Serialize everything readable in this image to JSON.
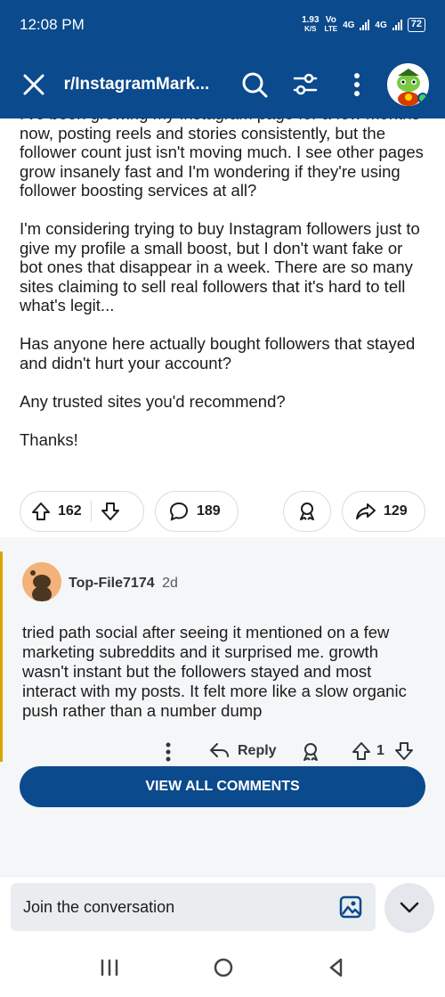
{
  "status_bar": {
    "time": "12:08 PM",
    "speed_value": "1.93",
    "speed_unit": "K/S",
    "volte_top": "Vo",
    "volte_bottom": "LTE",
    "net1": "4G",
    "net2": "4G",
    "battery": "72"
  },
  "header": {
    "subreddit": "r/InstagramMark...",
    "icons": [
      "close-icon",
      "search-icon",
      "filter-icon",
      "more-vertical-icon"
    ]
  },
  "post": {
    "paragraphs": [
      "I've been growing my Instagram page for a few months now, posting reels and stories consistently, but the follower count just isn't moving much. I see other pages grow insanely fast and I'm wondering if they're using follower boosting services at all?",
      "I'm considering trying to buy Instagram followers just to give my profile a small boost, but I don't want fake or bot ones that disappear in a week. There are so many sites claiming to sell real followers that it's hard to tell what's legit...",
      "Has anyone here actually bought followers that stayed and didn't hurt your account?",
      "Any trusted sites you'd recommend?",
      "Thanks!"
    ],
    "upvotes": "162",
    "comments": "189",
    "shares": "129"
  },
  "comment": {
    "username": "Top-File7174",
    "age": "2d",
    "body": "tried path social after seeing it mentioned on a few marketing subreddits and it surprised me. growth wasn't instant but the followers stayed and most interact with my posts. It felt more like a slow organic push rather than a number dump",
    "reply_label": "Reply",
    "votes": "1"
  },
  "view_all_label": "VIEW ALL COMMENTS",
  "composer": {
    "placeholder": "Join the conversation"
  },
  "colors": {
    "brand": "#0b4a8c",
    "thread_line": "#d9a300",
    "online": "#46d160"
  }
}
